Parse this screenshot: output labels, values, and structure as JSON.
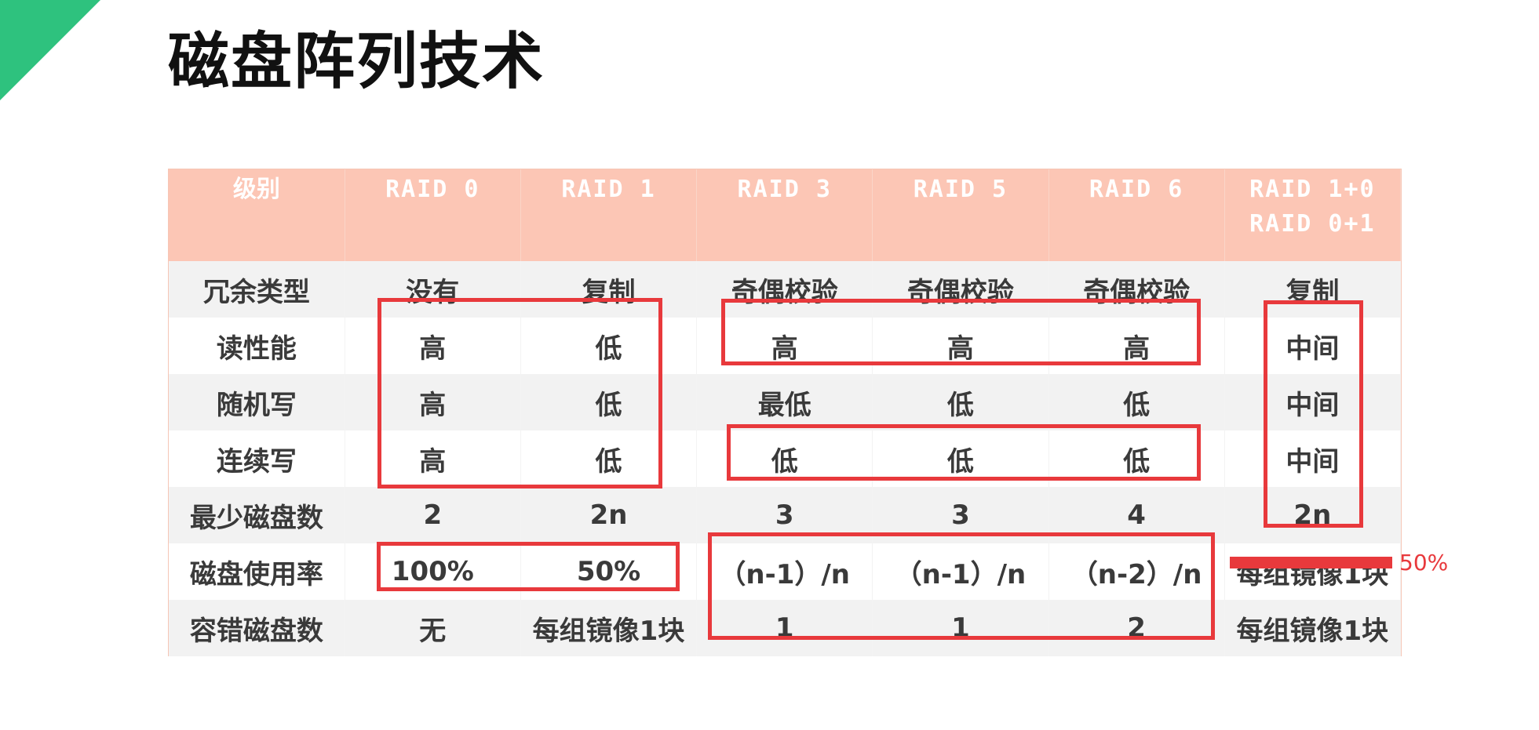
{
  "title": "磁盘阵列技术",
  "colors": {
    "accent_green": "#2ec27e",
    "header_bg": "#fcc6b5",
    "mark_red": "#e8393c"
  },
  "table": {
    "headers": [
      "级别",
      "RAID 0",
      "RAID 1",
      "RAID 3",
      "RAID 5",
      "RAID 6",
      [
        "RAID 1+0",
        "RAID 0+1"
      ]
    ],
    "rows": [
      [
        "冗余类型",
        "没有",
        "复制",
        "奇偶校验",
        "奇偶校验",
        "奇偶校验",
        "复制"
      ],
      [
        "读性能",
        "高",
        "低",
        "高",
        "高",
        "高",
        "中间"
      ],
      [
        "随机写",
        "高",
        "低",
        "最低",
        "低",
        "低",
        "中间"
      ],
      [
        "连续写",
        "高",
        "低",
        "低",
        "低",
        "低",
        "中间"
      ],
      [
        "最少磁盘数",
        "2",
        "2n",
        "3",
        "3",
        "4",
        "2n"
      ],
      [
        "磁盘使用率",
        "100%",
        "50%",
        "（n-1）/n",
        "（n-1）/n",
        "（n-2）/n",
        "每组镜像1块"
      ],
      [
        "容错磁盘数",
        "无",
        "每组镜像1块",
        "1",
        "1",
        "2",
        "每组镜像1块"
      ]
    ]
  },
  "annotation": {
    "replacement_text": "50%"
  }
}
